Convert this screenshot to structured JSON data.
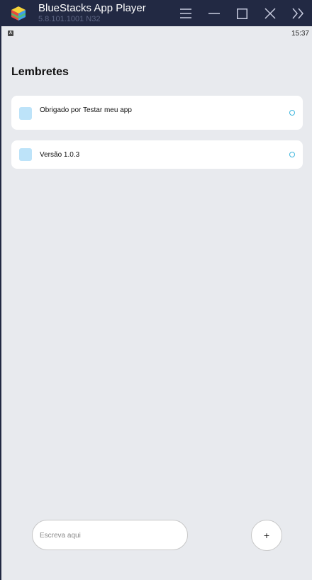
{
  "window": {
    "app_title": "BlueStacks App Player",
    "version": "5.8.101.1001 N32",
    "controls": [
      "menu-icon",
      "minimize-icon",
      "maximize-icon",
      "close-icon",
      "collapse-sidebar-icon"
    ]
  },
  "statusbar": {
    "time": "15:37",
    "indicator_letter": "A"
  },
  "page": {
    "title": "Lembretes"
  },
  "reminders": [
    {
      "text": "Obrigado por Testar meu app",
      "checkbox_color": "#bde3f9",
      "radio_color": "#3fb6dd"
    },
    {
      "text": "Versão 1.0.3",
      "checkbox_color": "#bde3f9",
      "radio_color": "#3fb6dd"
    }
  ],
  "composer": {
    "placeholder": "Escreva aqui",
    "value": "",
    "add_label": "+"
  },
  "colors": {
    "titlebar": "#222943",
    "background": "#e8eaee",
    "accent": "#3fb6dd"
  }
}
